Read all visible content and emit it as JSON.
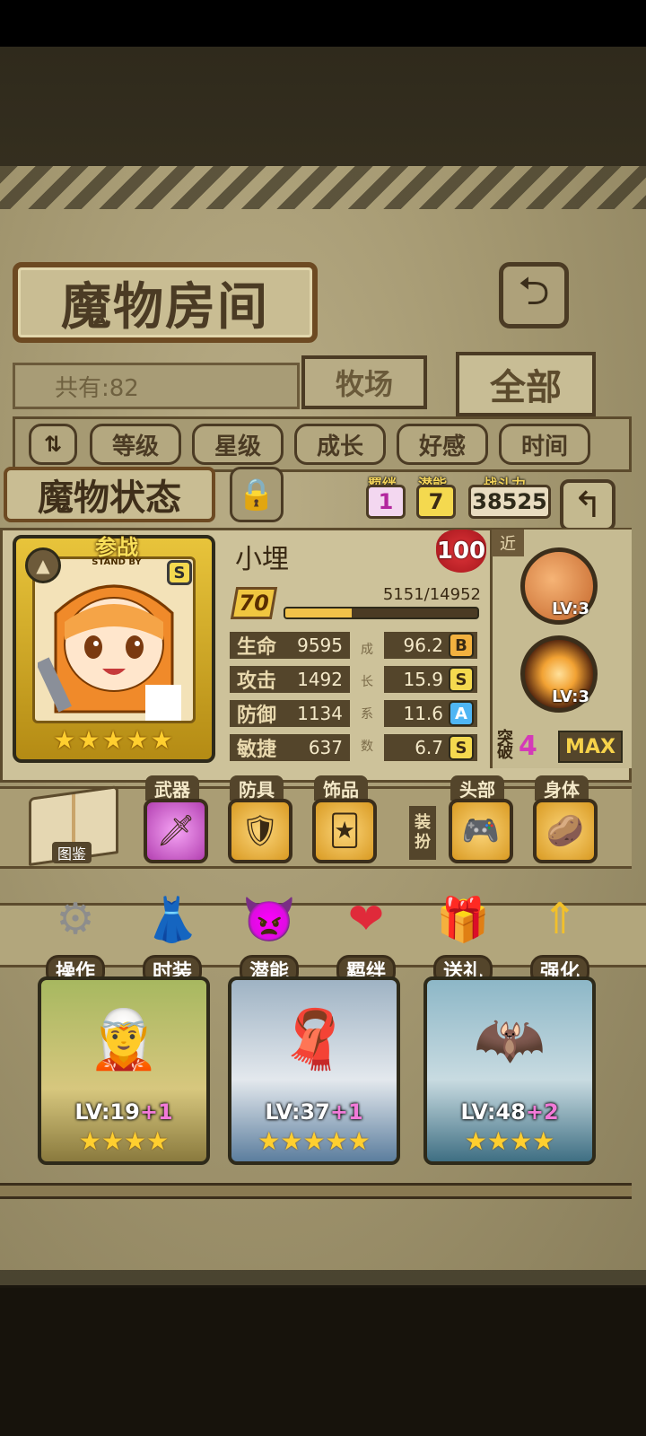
{
  "screen": {
    "title": "魔物房间",
    "back_icon": "return-icon",
    "count_text": "共有:82",
    "tabs": [
      "牧场",
      "全部"
    ],
    "sort_buttons": [
      "等级",
      "星级",
      "成长",
      "好感",
      "时间"
    ]
  },
  "status": {
    "title": "魔物状态",
    "bond_label": "羁绊",
    "bond_value": "1",
    "potential_label": "潜能",
    "potential_value": "7",
    "power_label": "战斗力",
    "power_value": "38525"
  },
  "monster": {
    "name": "小埋",
    "affection": "100",
    "standby_cn": "参战",
    "standby_en": "STAND BY",
    "rank": "S",
    "stars": 5,
    "level": "70",
    "exp_text": "5151/14952",
    "exp_fraction": 0.344,
    "stats": [
      {
        "label": "生命",
        "value": "9595",
        "growth": "96.2",
        "grade": "B"
      },
      {
        "label": "攻击",
        "value": "1492",
        "growth": "15.9",
        "grade": "S"
      },
      {
        "label": "防御",
        "value": "1134",
        "growth": "11.6",
        "grade": "A"
      },
      {
        "label": "敏捷",
        "value": "637",
        "growth": "6.7",
        "grade": "S"
      }
    ],
    "growth_vertical": [
      "成",
      "长",
      "系",
      "数"
    ],
    "attack_type": "近",
    "skills": [
      {
        "lv": "LV:3"
      },
      {
        "lv": "LV:3"
      }
    ],
    "break_label": "突破",
    "break_value": "4",
    "max_label": "MAX"
  },
  "equipment": {
    "book_label": "图鉴",
    "slots": [
      {
        "label": "武器",
        "icon": "sword-icon"
      },
      {
        "label": "防具",
        "icon": "shield-icon"
      },
      {
        "label": "饰品",
        "icon": "card-icon"
      },
      {
        "label": "头部",
        "icon": "gamepad-icon"
      },
      {
        "label": "身体",
        "icon": "potato-icon"
      }
    ],
    "vertical_label": "装扮"
  },
  "actions": [
    {
      "label": "操作",
      "icon": "gear-icon"
    },
    {
      "label": "时装",
      "icon": "outfit-icon"
    },
    {
      "label": "潜能",
      "icon": "demon-icon"
    },
    {
      "label": "羁绊",
      "icon": "hearts-icon"
    },
    {
      "label": "送礼",
      "icon": "gift-icon"
    },
    {
      "label": "强化",
      "icon": "upgrade-arrows-icon"
    }
  ],
  "roster": [
    {
      "lv": "LV:19",
      "plus": "+1",
      "stars": 4
    },
    {
      "lv": "LV:37",
      "plus": "+1",
      "stars": 5
    },
    {
      "lv": "LV:48",
      "plus": "+2",
      "stars": 4
    }
  ]
}
